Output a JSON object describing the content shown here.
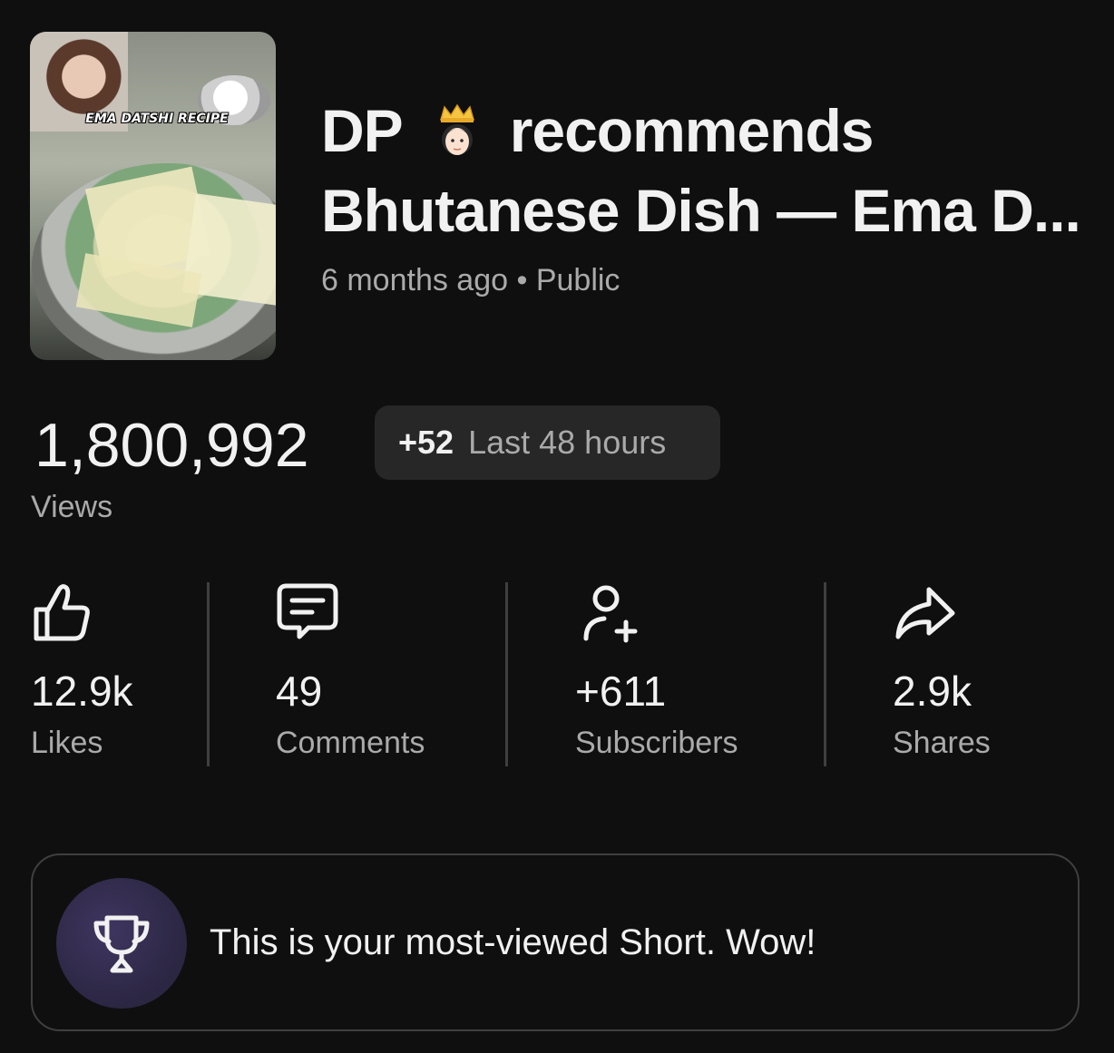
{
  "video": {
    "title_line1_start": "DP",
    "title_line1_end": "recommends",
    "title_line2": "Bhutanese Dish — Ema D...",
    "title_emoji": "princess-emoji",
    "meta": "6 months ago • Public",
    "thumbnail_caption": "EMA DATSHI RECIPE"
  },
  "views": {
    "count": "1,800,992",
    "label": "Views",
    "delta": "+52",
    "delta_label": "Last 48 hours"
  },
  "stats": [
    {
      "icon": "thumbs-up-icon",
      "value": "12.9k",
      "label": "Likes"
    },
    {
      "icon": "comment-icon",
      "value": "49",
      "label": "Comments"
    },
    {
      "icon": "add-person-icon",
      "value": "+611",
      "label": "Subscribers"
    },
    {
      "icon": "share-icon",
      "value": "2.9k",
      "label": "Shares"
    }
  ],
  "banner": {
    "icon": "trophy-icon",
    "text": "This is your most-viewed Short. Wow!"
  },
  "colors": {
    "background": "#0f0f0f",
    "text_primary": "#f1f1f1",
    "text_secondary": "#aaaaaa",
    "chip_bg": "#272727",
    "trophy_bg": "#2b2642"
  }
}
